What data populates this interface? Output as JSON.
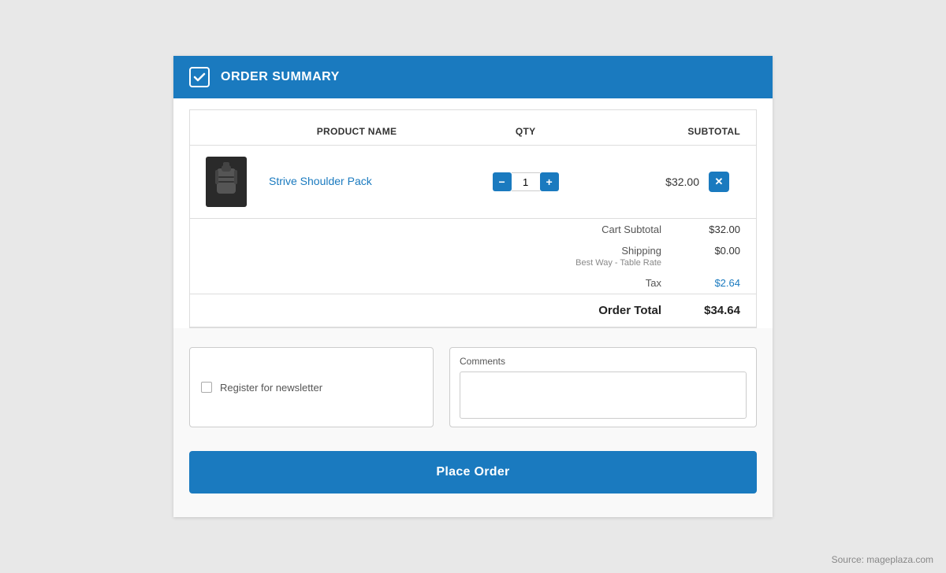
{
  "header": {
    "title": "ORDER SUMMARY"
  },
  "table": {
    "columns": {
      "product_name": "PRODUCT NAME",
      "qty": "QTY",
      "subtotal": "SUBTOTAL"
    },
    "items": [
      {
        "name": "Strive Shoulder Pack",
        "qty": 1,
        "subtotal": "$32.00"
      }
    ]
  },
  "totals": {
    "cart_subtotal_label": "Cart Subtotal",
    "cart_subtotal_value": "$32.00",
    "shipping_label": "Shipping",
    "shipping_method": "Best Way - Table Rate",
    "shipping_value": "$0.00",
    "tax_label": "Tax",
    "tax_value": "$2.64",
    "order_total_label": "Order Total",
    "order_total_value": "$34.64"
  },
  "newsletter": {
    "label": "Register for newsletter"
  },
  "comments": {
    "label": "Comments",
    "placeholder": ""
  },
  "actions": {
    "place_order": "Place Order"
  },
  "source": "Source: mageplaza.com"
}
